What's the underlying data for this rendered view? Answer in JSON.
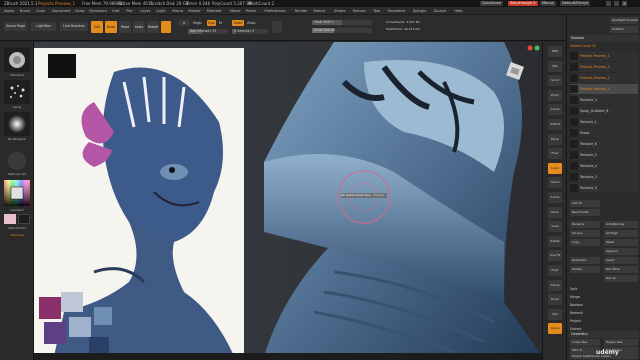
{
  "titlebar": {
    "app": "ZBrush 2021.5.1",
    "project": "Projects Preview_1",
    "free_mem": "Free Mem 79.989GB",
    "active_mem": "Active Mem 4015",
    "scratch": "Scratch Disk 29 GB",
    "timer": "Timer 0.046",
    "poly": "PolyCount 5.307 SM",
    "mesh": "MeshCount 2",
    "quicksave": "QuickSave",
    "see_through": "See-through 0",
    "menus": "Menus",
    "default_script": "DefaultZScript"
  },
  "menubar": [
    "Alpha",
    "Brush",
    "Color",
    "Document",
    "Draw",
    "Dynamics",
    "Edit",
    "File",
    "Layer",
    "Light",
    "Macro",
    "Marker",
    "Material",
    "Movie",
    "Picker",
    "Preferences",
    "Render",
    "Stencil",
    "Stroke",
    "Texture",
    "Tool",
    "Transform",
    "Zplugin",
    "Zscript",
    "Help"
  ],
  "shelf": {
    "home_page": "Home Page",
    "lightbox": "LightBox",
    "live_boolean": "Live Boolean",
    "edit": "Edit",
    "draw": "Draw",
    "move": "Move",
    "scale": "Scale",
    "rotate": "Rotate",
    "mrgb": "Mrgb",
    "rgb": "Rgb",
    "m": "M",
    "zadd": "Zadd",
    "zsub": "Zsub",
    "rgb_intensity": "Rgb Intensity 35",
    "z_intensity": "Z Intensity 5",
    "focal_shift": "Focal Shift 0",
    "draw_size": "Draw Size 64",
    "dynamic": "Dynamic",
    "active_points": "ActivePoints: 4.307 Mil",
    "total_points": "TotalPoints: 46.672 Mil"
  },
  "inforow": "-0.332,0.945,-0.290",
  "leftshelf": {
    "brush1": "Standard",
    "brush2": "Spray",
    "brush3": "BrushAlpha",
    "material": "FlatColor SS",
    "gradient": "Gradient",
    "switch_color": "SwitchColor",
    "alternate": "Alternate"
  },
  "viewport": {
    "brush_cursor_label": "SP-QADV Draw Size",
    "brush_cursor_value": "Frontal"
  },
  "rstrip": [
    "BPR",
    "SPix",
    "Scroll",
    "Zoom",
    "Actual",
    "AAHalf",
    "Persp",
    "Floor",
    "Local",
    "Gizmo",
    "Frame",
    "Move",
    "Scale",
    "Rotate",
    "Line Fill",
    "PolyF",
    "Transp",
    "Ghost",
    "Solo",
    "Xpose"
  ],
  "rpanel": {
    "spotlight_top": "Spotlight Projection",
    "subtool_btn": "SubTool",
    "subtool_header": "Subtool",
    "visible_count": "Visible Count 10",
    "items": [
      "Projects Preview_1",
      "Projects Preview_3",
      "Projects Preview_2",
      "Projects Preview_4",
      "Tentacle_3",
      "Spray_Gradient_B",
      "Tentacle_1",
      "Ghost",
      "Tentacle_6",
      "Tentacle_5",
      "Tentacle_4",
      "Tentacle_2",
      "Tentacle_9"
    ],
    "list_all": "List All",
    "new_folder": "New Folder",
    "rename": "Rename",
    "autoreorder": "AutoReorder",
    "all_low": "All Low",
    "all_high": "All High",
    "copy": "Copy",
    "paste": "Paste",
    "append": "Append",
    "duplicate": "Duplicate",
    "insert": "Insert",
    "delete": "Delete",
    "del_other": "Del Other",
    "del_all": "Del All",
    "split": "Split",
    "merge": "Merge",
    "boolean": "Boolean",
    "remesh": "Remesh",
    "project": "Project",
    "extract": "Extract",
    "geometry": "Geometry",
    "lower_res": "Lower Res",
    "higher_res": "Higher Res",
    "sdiv": "SDiv 8",
    "del_lower": "Del Lower",
    "del_higher": "Del Higher",
    "freeze": "Freeze SubDivision Levels"
  },
  "watermark": "udemy",
  "colors": {
    "accent": "#e38b1d",
    "panel": "#2b2b2b",
    "title": "#141414"
  }
}
